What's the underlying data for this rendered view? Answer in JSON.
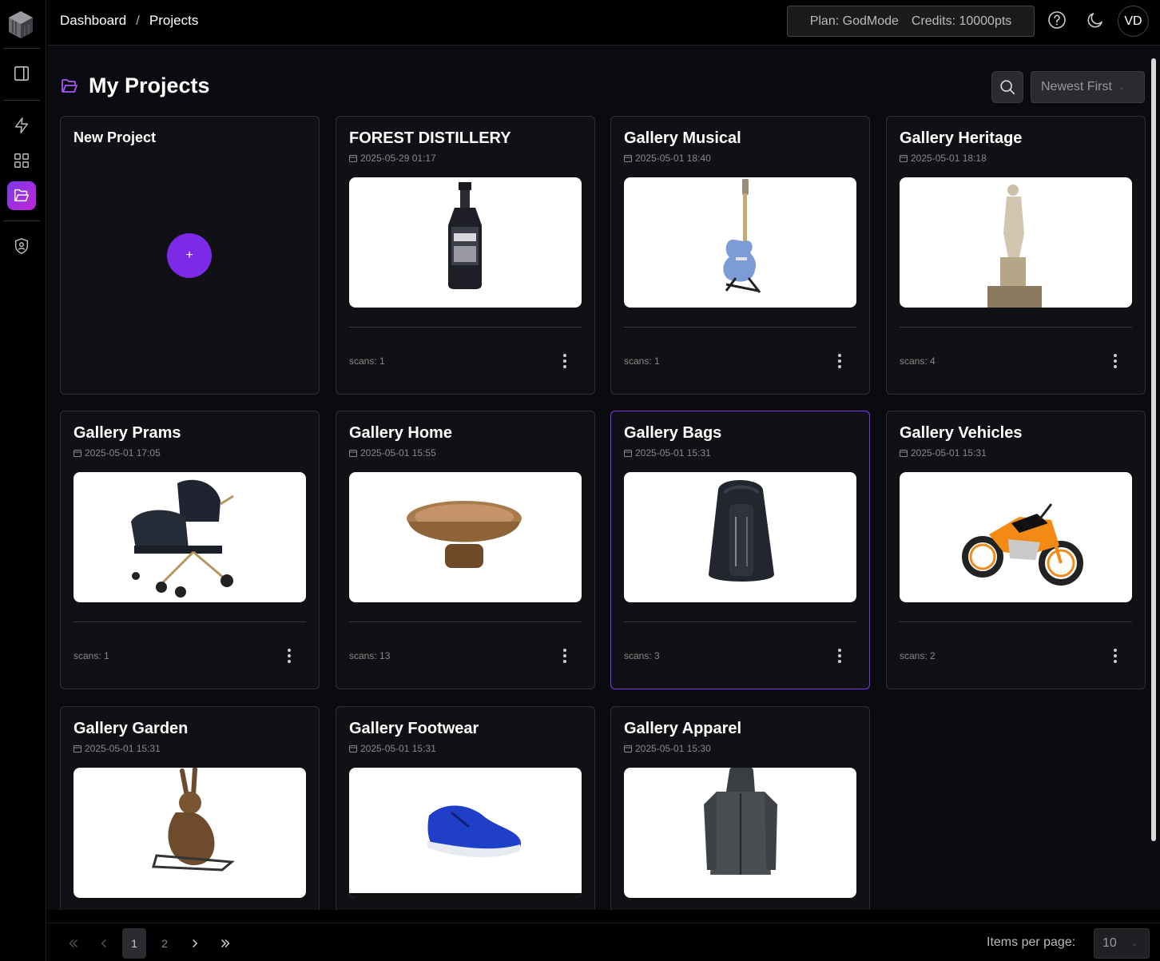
{
  "breadcrumb": {
    "home": "Dashboard",
    "separator": "/",
    "current": "Projects"
  },
  "account": {
    "plan": "Plan: GodMode",
    "credits": "Credits: 10000pts",
    "avatar_initials": "VD"
  },
  "page": {
    "title": "My Projects"
  },
  "sort": {
    "selected": "Newest First"
  },
  "new_project": {
    "title": "New Project",
    "add_label": "+"
  },
  "projects": [
    {
      "title": "FOREST DISTILLERY",
      "date": "2025-05-29 01:17",
      "scans": "scans: 1",
      "thumb_icon": "bottle"
    },
    {
      "title": "Gallery Musical",
      "date": "2025-05-01 18:40",
      "scans": "scans: 1",
      "thumb_icon": "guitar"
    },
    {
      "title": "Gallery Heritage",
      "date": "2025-05-01 18:18",
      "scans": "scans: 4",
      "thumb_icon": "statue"
    },
    {
      "title": "Gallery Prams",
      "date": "2025-05-01 17:05",
      "scans": "scans: 1",
      "thumb_icon": "pram"
    },
    {
      "title": "Gallery Home",
      "date": "2025-05-01 15:55",
      "scans": "scans: 13",
      "thumb_icon": "bowl"
    },
    {
      "title": "Gallery Bags",
      "date": "2025-05-01 15:31",
      "scans": "scans: 3",
      "thumb_icon": "backpack"
    },
    {
      "title": "Gallery Vehicles",
      "date": "2025-05-01 15:31",
      "scans": "scans: 2",
      "thumb_icon": "motorcycle"
    },
    {
      "title": "Gallery Garden",
      "date": "2025-05-01 15:31",
      "scans": "",
      "thumb_icon": "rabbit-sculpture"
    },
    {
      "title": "Gallery Footwear",
      "date": "2025-05-01 15:31",
      "scans": "",
      "thumb_icon": "shoe"
    },
    {
      "title": "Gallery Apparel",
      "date": "2025-05-01 15:30",
      "scans": "",
      "thumb_icon": "jacket"
    }
  ],
  "pagination": {
    "pages": [
      "1",
      "2"
    ],
    "current": "1",
    "items_per_page_label": "Items per page:",
    "items_per_page": "10"
  },
  "colors": {
    "accent": "#7c3aed",
    "accent_gradient_end": "#c026d3",
    "card_bg": "#101114",
    "main_bg": "#0a0b0f"
  }
}
